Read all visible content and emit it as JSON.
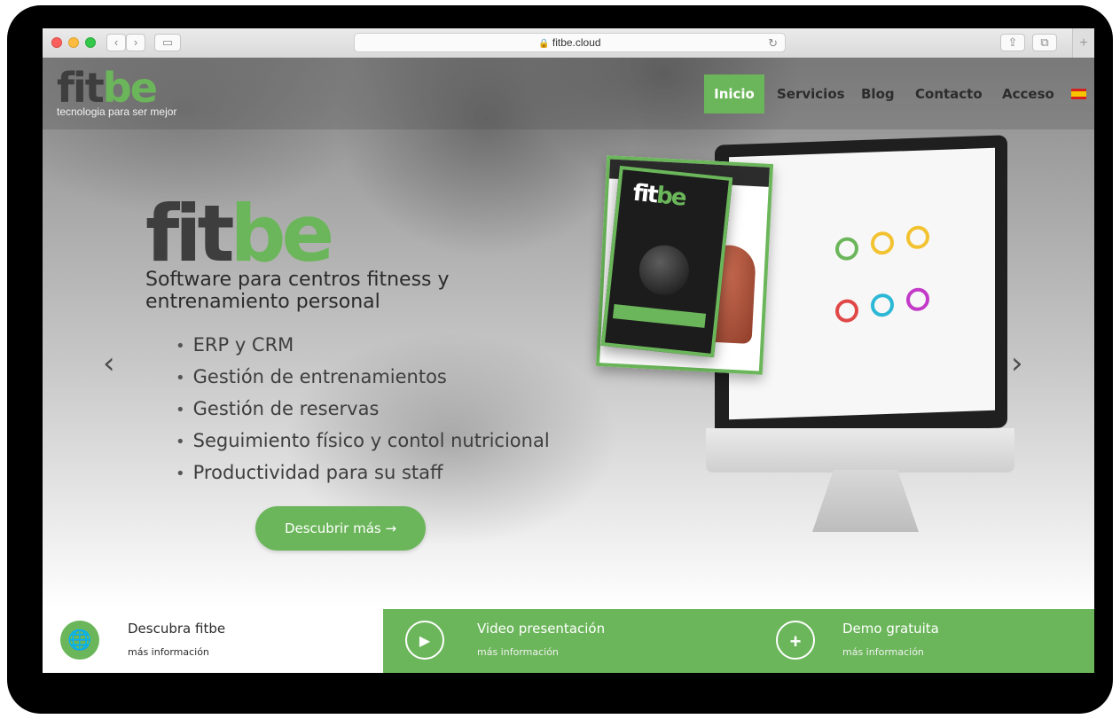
{
  "browser": {
    "url": "fitbe.cloud",
    "back_glyph": "‹",
    "forward_glyph": "›",
    "sidebar_glyph": "▭",
    "reload_glyph": "↻",
    "share_glyph": "⇪",
    "tabs_glyph": "⧉",
    "newtab_glyph": "+"
  },
  "header": {
    "logo_fit": "fit",
    "logo_be": "be",
    "tagline": "tecnologia para ser mejor",
    "menu": [
      {
        "label": "Inicio",
        "active": true
      },
      {
        "label": "Servicios",
        "active": false
      },
      {
        "label": "Blog",
        "active": false
      },
      {
        "label": "Contacto",
        "active": false
      },
      {
        "label": "Acceso",
        "active": false
      }
    ],
    "language_icon": "spain-flag-icon"
  },
  "hero": {
    "logo_fit": "fit",
    "logo_be": "be",
    "title_line1": "Software para centros fitness y",
    "title_line2": "entrenamiento personal",
    "features": [
      "ERP y CRM",
      "Gestión de entrenamientos",
      "Gestión de reservas",
      "Seguimiento físico y contol nutricional",
      "Productividad para su staff"
    ],
    "cta_label": "Descubrir más →",
    "prev_glyph": "‹",
    "next_glyph": "›",
    "slide_count": 2,
    "active_slide": 1,
    "mockup_phone_logo_fit": "fit",
    "mockup_phone_logo_be": "be"
  },
  "bottom_bar": [
    {
      "title": "Descubra fitbe",
      "link": "más información",
      "icon": "globe-icon",
      "icon_glyph": "🌐"
    },
    {
      "title": "Video presentación",
      "link": "más información",
      "icon": "video-camera-icon",
      "icon_glyph": "▶"
    },
    {
      "title": "Demo gratuita",
      "link": "más información",
      "icon": "add-user-icon",
      "icon_glyph": "+"
    }
  ],
  "colors": {
    "accent": "#6bb65a",
    "dark_text": "#2c2c2c",
    "logo_dark": "#3e3e3e"
  }
}
